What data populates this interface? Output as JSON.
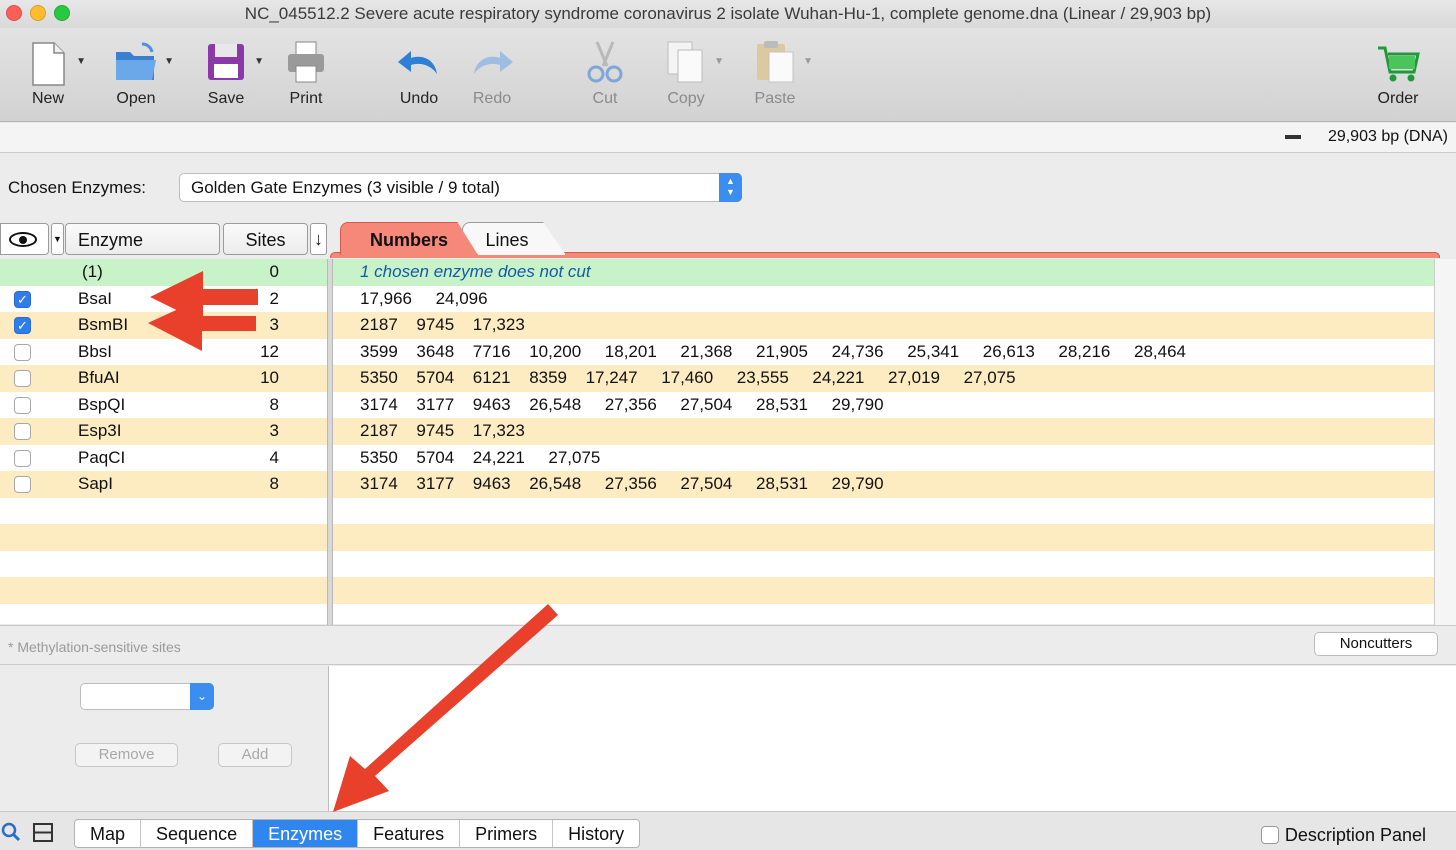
{
  "window": {
    "title": "NC_045512.2 Severe acute respiratory syndrome coronavirus 2 isolate Wuhan-Hu-1, complete genome.dna  (Linear / 29,903 bp)"
  },
  "toolbar": {
    "new": "New",
    "open": "Open",
    "save": "Save",
    "print": "Print",
    "undo": "Undo",
    "redo": "Redo",
    "cut": "Cut",
    "copy": "Copy",
    "paste": "Paste",
    "order": "Order"
  },
  "sequence_info": "29,903 bp   (DNA)",
  "chosen": {
    "label": "Chosen Enzymes:",
    "value": "Golden Gate Enzymes  (3 visible / 9 total)"
  },
  "table": {
    "col_enzyme": "Enzyme",
    "col_sites": "Sites",
    "tab_numbers": "Numbers",
    "tab_lines": "Lines",
    "summary": {
      "name": "(1)",
      "sites": "0",
      "note": "1 chosen enzyme does not cut"
    },
    "rows": [
      {
        "checked": true,
        "name": "BsaI",
        "sites": "2",
        "positions": [
          "17,966",
          "24,096"
        ]
      },
      {
        "checked": true,
        "name": "BsmBI",
        "sites": "3",
        "positions": [
          "2187",
          "9745",
          "17,323"
        ]
      },
      {
        "checked": false,
        "name": "BbsI",
        "sites": "12",
        "positions": [
          "3599",
          "3648",
          "7716",
          "10,200",
          "18,201",
          "21,368",
          "21,905",
          "24,736",
          "25,341",
          "26,613",
          "28,216",
          "28,464"
        ]
      },
      {
        "checked": false,
        "name": "BfuAI",
        "sites": "10",
        "positions": [
          "5350",
          "5704",
          "6121",
          "8359",
          "17,247",
          "17,460",
          "23,555",
          "24,221",
          "27,019",
          "27,075"
        ]
      },
      {
        "checked": false,
        "name": "BspQI",
        "sites": "8",
        "positions": [
          "3174",
          "3177",
          "9463",
          "26,548",
          "27,356",
          "27,504",
          "28,531",
          "29,790"
        ]
      },
      {
        "checked": false,
        "name": "Esp3I",
        "sites": "3",
        "positions": [
          "2187",
          "9745",
          "17,323"
        ]
      },
      {
        "checked": false,
        "name": "PaqCI",
        "sites": "4",
        "positions": [
          "5350",
          "5704",
          "24,221",
          "27,075"
        ]
      },
      {
        "checked": false,
        "name": "SapI",
        "sites": "8",
        "positions": [
          "3174",
          "3177",
          "9463",
          "26,548",
          "27,356",
          "27,504",
          "28,531",
          "29,790"
        ]
      }
    ]
  },
  "methylation_note": "* Methylation-sensitive sites",
  "noncutters": "Noncutters",
  "remove": "Remove",
  "add": "Add",
  "footer_tabs": [
    "Map",
    "Sequence",
    "Enzymes",
    "Features",
    "Primers",
    "History"
  ],
  "active_footer_tab": "Enzymes",
  "description_panel": "Description Panel",
  "colors": {
    "annotation_arrow": "#e8402b",
    "accent": "#2f86ee",
    "row_alt": "#fdebc2",
    "row_highlight": "#c8f3c9"
  }
}
